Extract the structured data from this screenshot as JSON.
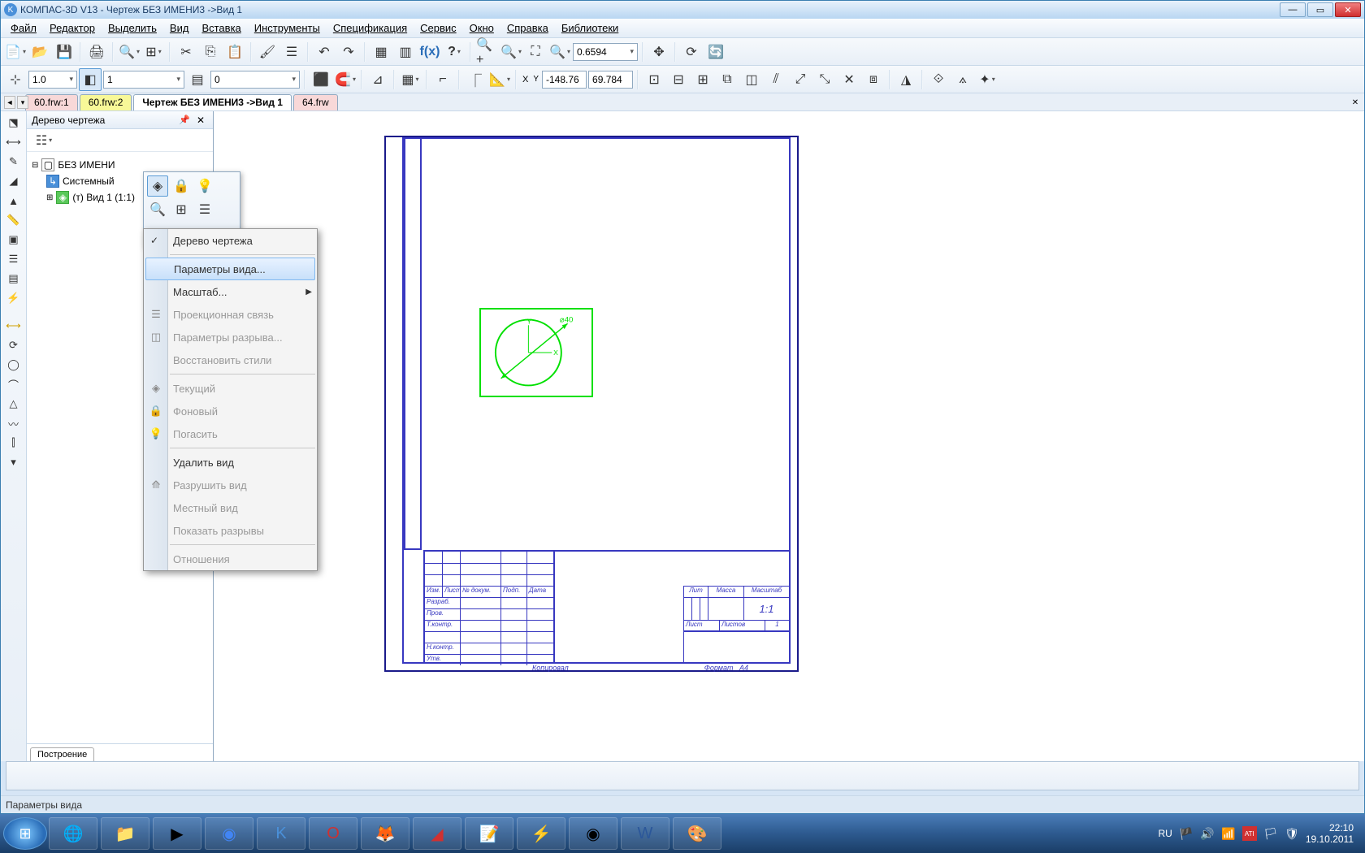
{
  "window": {
    "title": "КОМПАС-3D V13 - Чертеж БЕЗ ИМЕНИ3 ->Вид 1"
  },
  "menu": {
    "file": "Файл",
    "editor": "Редактор",
    "select": "Выделить",
    "view": "Вид",
    "insert": "Вставка",
    "tools": "Инструменты",
    "spec": "Спецификация",
    "service": "Сервис",
    "window": "Окно",
    "help": "Справка",
    "libs": "Библиотеки"
  },
  "toolbar1": {
    "zoom_val": "0.6594"
  },
  "toolbar2": {
    "step": "1.0",
    "layer": "1",
    "style": "0",
    "x_label": "X",
    "y_label": "Y",
    "x_val": "-148.76",
    "y_val": "69.784"
  },
  "tabs": {
    "t1": "60.frw:1",
    "t2": "60.frw:2",
    "t3": "Чертеж БЕЗ ИМЕНИ3 ->Вид 1",
    "t4": "64.frw"
  },
  "tree": {
    "title": "Дерево чертежа",
    "root": "БЕЗ ИМЕНИ",
    "sys": "Системный",
    "view": "(т) Вид 1 (1:1)",
    "bottom_tab": "Построение"
  },
  "ctx": {
    "i1": "Дерево чертежа",
    "i2": "Параметры вида...",
    "i3": "Масштаб...",
    "i4": "Проекционная связь",
    "i5": "Параметры разрыва...",
    "i6": "Восстановить стили",
    "i7": "Текущий",
    "i8": "Фоновый",
    "i9": "Погасить",
    "i10": "Удалить вид",
    "i11": "Разрушить вид",
    "i12": "Местный вид",
    "i13": "Показать разрывы",
    "i14": "Отношения"
  },
  "titleblock": {
    "lit": "Лит",
    "mass": "Масса",
    "scale": "Масштаб",
    "scale_val": "1:1",
    "list": "Лист",
    "listov": "Листов",
    "one": "1",
    "izm": "Изм.",
    "list2": "Лист",
    "ndoc": "№ докум.",
    "podp": "Подп.",
    "data": "Дата",
    "razrab": "Разраб.",
    "prov": "Пров.",
    "tkontr": "Т.контр.",
    "nkontr": "Н.контр.",
    "utv": "Утв.",
    "kopir": "Копировал",
    "format": "Формат",
    "a4": "A4",
    "dim": "⌀40"
  },
  "status": {
    "text": "Параметры вида"
  },
  "taskbar": {
    "lang": "RU",
    "time": "22:10",
    "date": "19.10.2011"
  }
}
